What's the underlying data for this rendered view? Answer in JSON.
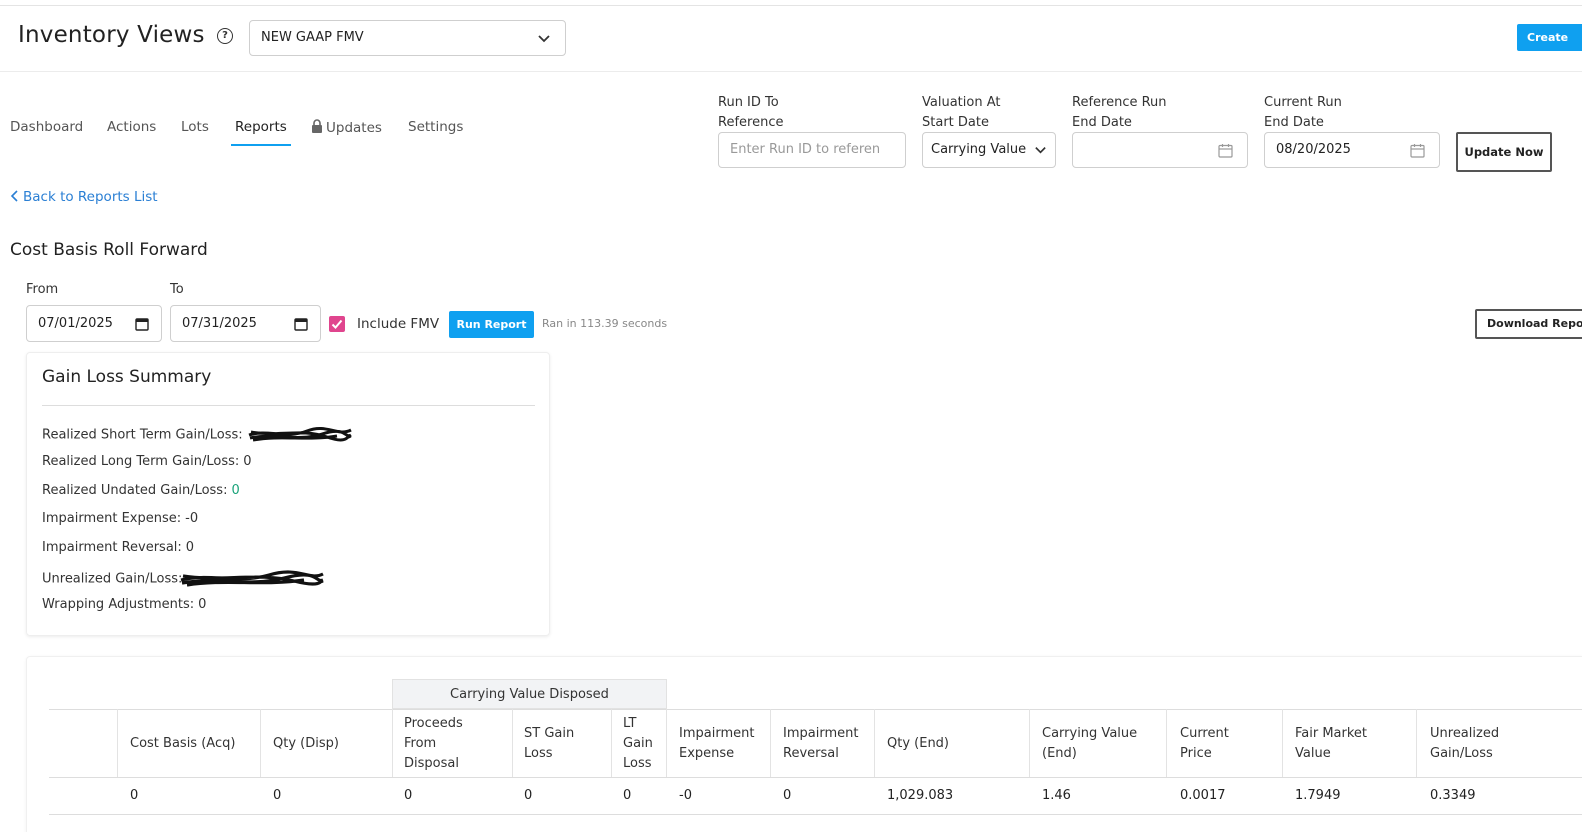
{
  "header": {
    "title": "Inventory Views",
    "help_icon": "question-circle-icon",
    "view_select": "NEW GAAP FMV",
    "create_label": "Create"
  },
  "tabs": [
    {
      "label": "Dashboard"
    },
    {
      "label": "Actions"
    },
    {
      "label": "Lots"
    },
    {
      "label": "Reports",
      "active": true
    },
    {
      "label": "Updates",
      "icon": "lock-icon"
    },
    {
      "label": "Settings"
    }
  ],
  "filters": {
    "run_id": {
      "label_1": "Run ID To",
      "label_2": "Reference",
      "placeholder": "Enter Run ID to referen"
    },
    "valuation": {
      "label_1": "Valuation At",
      "label_2": "Start Date",
      "value": "Carrying Value"
    },
    "ref_end": {
      "label_1": "Reference Run",
      "label_2": "End Date",
      "value": ""
    },
    "cur_end": {
      "label_1": "Current Run",
      "label_2": "End Date",
      "value": "08/20/2025"
    },
    "update_label": "Update Now"
  },
  "back_link": "Back to Reports List",
  "report": {
    "title": "Cost Basis Roll Forward",
    "from_label": "From",
    "from_value": "07/01/2025",
    "to_label": "To",
    "to_value": "07/31/2025",
    "include_fmv_label": "Include FMV",
    "include_fmv_checked": true,
    "run_label": "Run Report",
    "ran_text": "Ran in 113.39 seconds",
    "download_label": "Download Report"
  },
  "summary": {
    "title": "Gain Loss Summary",
    "rows": [
      {
        "label": "Realized Short Term Gain/Loss:",
        "value": ""
      },
      {
        "label": "Realized Long Term Gain/Loss:",
        "value": "0"
      },
      {
        "label": "Realized Undated Gain/Loss:",
        "value": "0"
      },
      {
        "label": "Impairment Expense:",
        "value": "-0"
      },
      {
        "label": "Impairment Reversal:",
        "value": "0"
      },
      {
        "label": "Unrealized Gain/Loss:",
        "value": ""
      },
      {
        "label": "Wrapping Adjustments:",
        "value": "0"
      }
    ]
  },
  "table": {
    "group_header": "Carrying Value Disposed",
    "columns": [
      {
        "l1": "Cost Basis (Acq)"
      },
      {
        "l1": "Qty (Disp)"
      },
      {
        "l1": "Proceeds",
        "l2": "From",
        "l3": "Disposal"
      },
      {
        "l1": "ST Gain",
        "l2": "Loss"
      },
      {
        "l1": "LT",
        "l2": "Gain",
        "l3": "Loss"
      },
      {
        "l1": "Impairment",
        "l2": "Expense"
      },
      {
        "l1": "Impairment",
        "l2": "Reversal"
      },
      {
        "l1": "Qty (End)"
      },
      {
        "l1": "Carrying Value",
        "l2": "(End)"
      },
      {
        "l1": "Current",
        "l2": "Price"
      },
      {
        "l1": "Fair Market",
        "l2": "Value"
      },
      {
        "l1": "Unrealized",
        "l2": "Gain/Loss"
      }
    ],
    "row": [
      "0",
      "0",
      "0",
      "0",
      "0",
      "-0",
      "0",
      "1,029.083",
      "1.46",
      "0.0017",
      "1.7949",
      "0.3349"
    ]
  },
  "colors": {
    "accent": "#0fa0f0",
    "checkbox": "#e0458e",
    "positive": "#1aa37a",
    "negative": "#e0403a"
  }
}
